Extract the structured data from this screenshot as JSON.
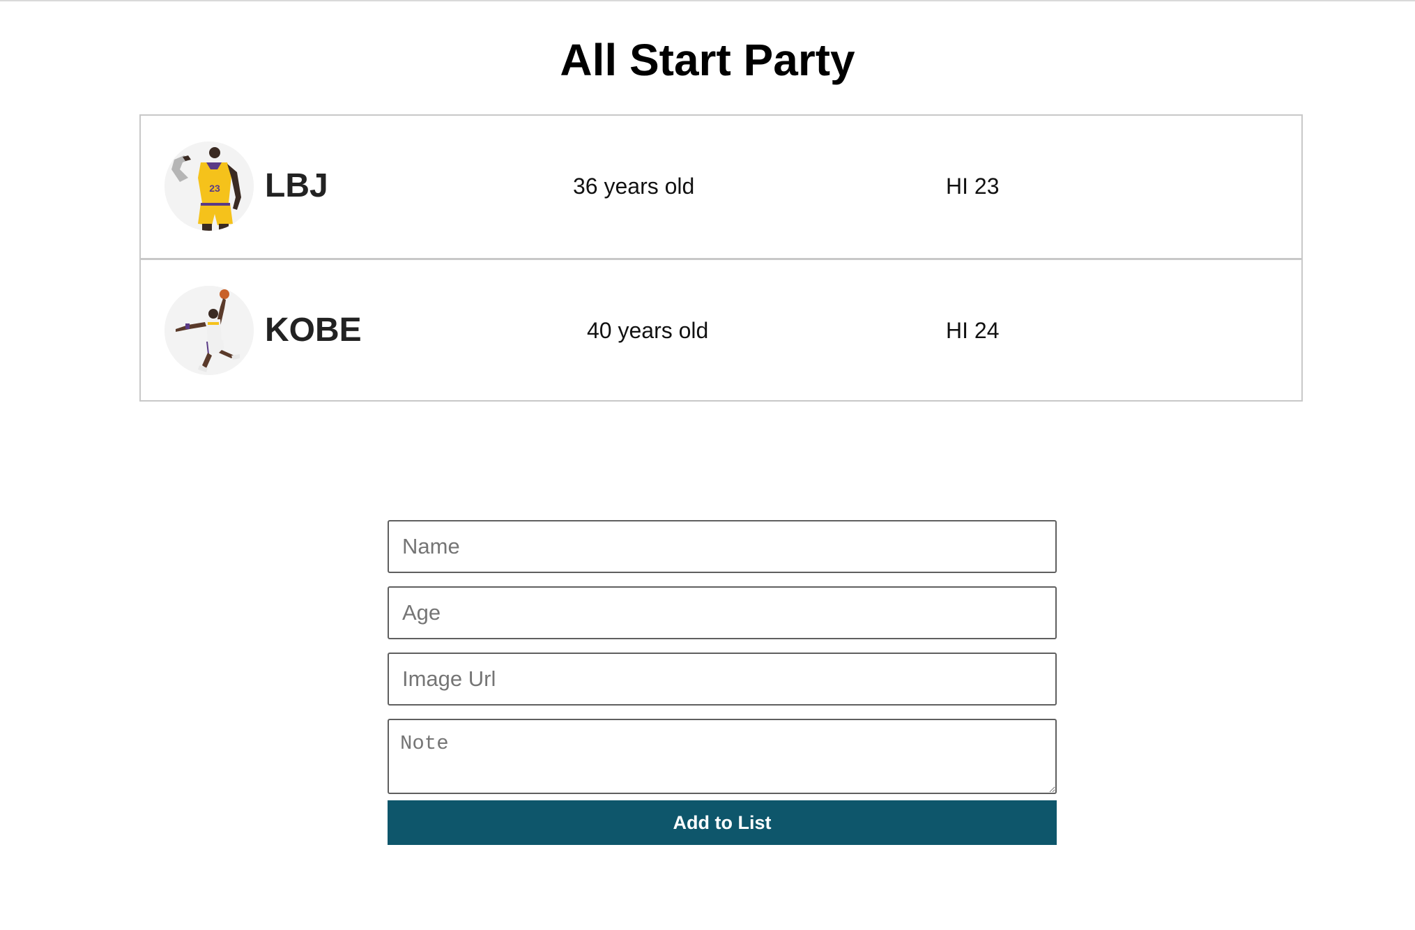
{
  "page": {
    "title": "All Start Party"
  },
  "players": [
    {
      "name": "LBJ",
      "age_text": "36 years old",
      "note": "HI 23",
      "avatar_icon": "basketball-player-flexing-icon",
      "jersey_color": "#f5c21b"
    },
    {
      "name": "KOBE",
      "age_text": "40 years old",
      "note": "HI 24",
      "avatar_icon": "basketball-player-dunking-icon",
      "jersey_color": "#f0f0f0"
    }
  ],
  "form": {
    "name_placeholder": "Name",
    "age_placeholder": "Age",
    "image_url_placeholder": "Image Url",
    "note_placeholder": "Note",
    "submit_label": "Add to List"
  },
  "colors": {
    "button_bg": "#0e566b",
    "border": "#c8c8c8"
  }
}
